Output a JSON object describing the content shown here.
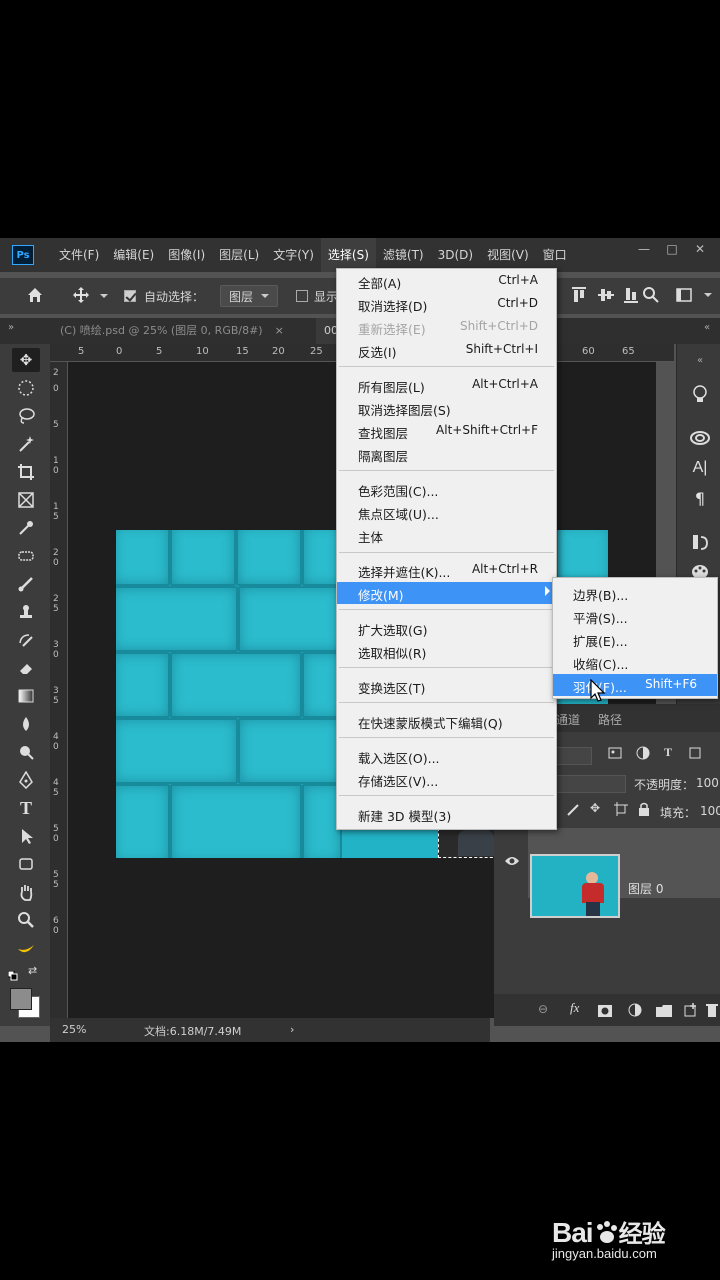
{
  "app": {
    "logo": "Ps"
  },
  "menubar": {
    "items": [
      "文件(F)",
      "编辑(E)",
      "图像(I)",
      "图层(L)",
      "文字(Y)",
      "选择(S)",
      "滤镜(T)",
      "3D(D)",
      "视图(V)",
      "窗口"
    ],
    "active_index": 5,
    "win_min": "—",
    "win_max": "□",
    "win_close": "✕"
  },
  "options_bar": {
    "auto_select_label": "自动选择：",
    "layer_select_value": "图层",
    "show_label": "显示"
  },
  "tabs": [
    {
      "label": "(C) 喷绘.psd @ 25% (图层 0, RGB/8#)",
      "close": "×"
    },
    {
      "label": "00"
    }
  ],
  "ruler": {
    "top_ticks": [
      "5",
      "0",
      "5",
      "10",
      "15",
      "20",
      "25",
      "60",
      "65"
    ],
    "left_ticks": [
      "2",
      "0",
      "5",
      "1 0",
      "1 5",
      "2 0",
      "2 5",
      "3 0",
      "3 5",
      "4 0",
      "4 5",
      "5 0",
      "5 5",
      "6 0"
    ]
  },
  "status": {
    "zoom": "25%",
    "doc": "文档:6.18M/7.49M",
    "arrow": "›"
  },
  "select_menu": {
    "items": [
      {
        "label": "全部(A)",
        "shortcut": "Ctrl+A"
      },
      {
        "label": "取消选择(D)",
        "shortcut": "Ctrl+D"
      },
      {
        "label": "重新选择(E)",
        "shortcut": "Shift+Ctrl+D",
        "disabled": true
      },
      {
        "label": "反选(I)",
        "shortcut": "Shift+Ctrl+I"
      },
      {
        "label": "所有图层(L)",
        "shortcut": "Alt+Ctrl+A"
      },
      {
        "label": "取消选择图层(S)",
        "shortcut": ""
      },
      {
        "label": "查找图层",
        "shortcut": "Alt+Shift+Ctrl+F"
      },
      {
        "label": "隔离图层",
        "shortcut": ""
      },
      {
        "label": "色彩范围(C)...",
        "shortcut": ""
      },
      {
        "label": "焦点区域(U)...",
        "shortcut": ""
      },
      {
        "label": "主体",
        "shortcut": ""
      },
      {
        "label": "选择并遮住(K)...",
        "shortcut": "Alt+Ctrl+R"
      },
      {
        "label": "修改(M)",
        "shortcut": "",
        "highlighted": true,
        "submenu": true
      },
      {
        "label": "扩大选取(G)",
        "shortcut": ""
      },
      {
        "label": "选取相似(R)",
        "shortcut": ""
      },
      {
        "label": "变换选区(T)",
        "shortcut": ""
      },
      {
        "label": "在快速蒙版模式下编辑(Q)",
        "shortcut": ""
      },
      {
        "label": "载入选区(O)...",
        "shortcut": ""
      },
      {
        "label": "存储选区(V)...",
        "shortcut": ""
      },
      {
        "label": "新建 3D 模型(3)",
        "shortcut": ""
      }
    ]
  },
  "modify_submenu": {
    "items": [
      {
        "label": "边界(B)...",
        "shortcut": ""
      },
      {
        "label": "平滑(S)...",
        "shortcut": ""
      },
      {
        "label": "扩展(E)...",
        "shortcut": ""
      },
      {
        "label": "收缩(C)...",
        "shortcut": ""
      },
      {
        "label": "羽化(F)...",
        "shortcut": "Shift+F6",
        "highlighted": true
      }
    ]
  },
  "layers_panel": {
    "tabs": [
      "通道",
      "路径"
    ],
    "opacity_label": "不透明度：",
    "opacity_value": "100",
    "fill_label": "填充：",
    "fill_value": "100",
    "layer_name": "图层 0"
  },
  "watermark": {
    "logo": "Bai経验",
    "logo_main": "Bai",
    "logo_cn": "经验",
    "url": "jingyan.baidu.com"
  },
  "colors": {
    "accent": "#3e93f6",
    "canvas": "#23b3c6",
    "ps_blue": "#31a8ff"
  }
}
